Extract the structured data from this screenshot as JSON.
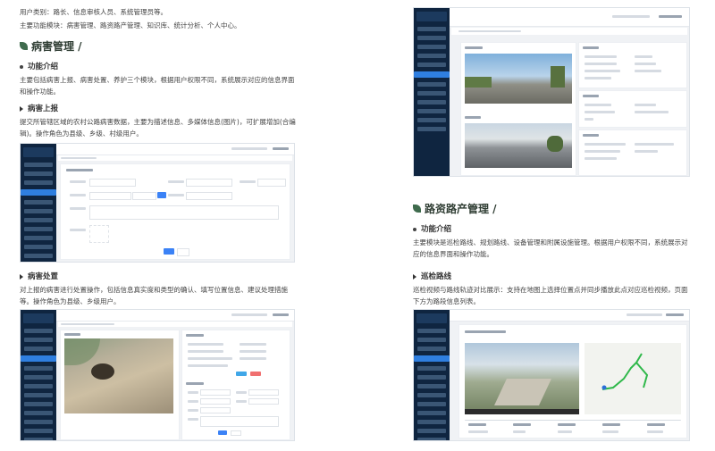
{
  "intro": {
    "users": "用户类别：路长、信息审核人员、系统管理员等。",
    "modules": "主要功能模块：病害管理、路资路产管理、知识库、统计分析、个人中心。"
  },
  "disease": {
    "title": "病害管理 /",
    "func_heading": "功能介绍",
    "func_text": "主要包括病害上报、病害处置、养护三个模块，根据用户权限不同，系统展示对应的信息界面和操作功能。",
    "report_heading": "病害上报",
    "report_text": "提交所管辖区域的农村公路病害数据，主要为描述信息、多媒体信息(图片)，可扩展增加(合编辑)。操作角色为县级、乡级、村级用户。",
    "handle_heading": "病害处置",
    "handle_text": "对上报的病害进行处置操作，包括信息真实度和类型的确认、填写位置信息、建议处理措施等。操作角色为县级、乡级用户。"
  },
  "asset": {
    "title": "路资路产管理 /",
    "func_heading": "功能介绍",
    "func_text": "主要模块是巡检路线、规划路线、设备管理和附属设施管理。根据用户权限不同，系统展示对应的信息界面和操作功能。",
    "patrol_heading": "巡检路线",
    "patrol_text": "巡检视频与路线轨迹对比展示：支持在地图上选择位置点并同步播放此点对应巡检视频，页面下方为路段信息列表。"
  },
  "colors": {
    "heading": "#2f3d33",
    "leaf": "#3f6b4d",
    "sidebar": "#0f2540",
    "accent": "#3b82f6"
  }
}
